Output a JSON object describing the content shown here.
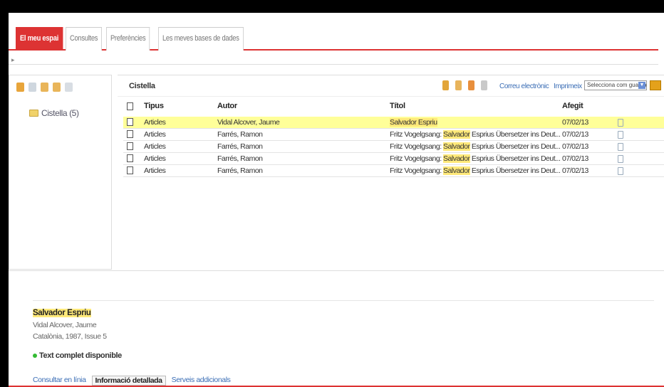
{
  "tabs": [
    "El meu espai",
    "Consultes",
    "Preferències",
    "Les meves bases de dades"
  ],
  "active_tab": 0,
  "basket": {
    "title": "Cistella",
    "folder_label": "Cistella (5)",
    "email_link": "Correu electrònic",
    "print_link": "Imprimeix",
    "select_value": "Selecciona com guardar"
  },
  "columns": {
    "type": "Tipus",
    "author": "Autor",
    "title": "Títol",
    "added": "Afegit"
  },
  "rows": [
    {
      "type": "Articles",
      "author": "Vidal Alcover, Jaume",
      "title_pre": "",
      "title_hl": "Salvador Espriu",
      "title_post": "",
      "added": "07/02/13",
      "highlighted": true
    },
    {
      "type": "Articles",
      "author": "Farrés, Ramon",
      "title_pre": "Fritz Vogelgsang: ",
      "title_hl": "Salvador",
      "title_post": " Esprius Übersetzer ins Deut...",
      "added": "07/02/13",
      "highlighted": false
    },
    {
      "type": "Articles",
      "author": "Farrés, Ramon",
      "title_pre": "Fritz Vogelgsang: ",
      "title_hl": "Salvador",
      "title_post": " Esprius Übersetzer ins Deut...",
      "added": "07/02/13",
      "highlighted": false
    },
    {
      "type": "Articles",
      "author": "Farrés, Ramon",
      "title_pre": "Fritz Vogelgsang: ",
      "title_hl": "Salvador",
      "title_post": " Esprius Übersetzer ins Deut...",
      "added": "07/02/13",
      "highlighted": false
    },
    {
      "type": "Articles",
      "author": "Farrés, Ramon",
      "title_pre": "Fritz Vogelgsang: ",
      "title_hl": "Salvador",
      "title_post": " Esprius Übersetzer ins Deut...",
      "added": "07/02/13",
      "highlighted": false
    }
  ],
  "detail": {
    "title": "Salvador Espriu",
    "author": "Vidal Alcover, Jaume",
    "source": "Catalònia, 1987, Issue 5",
    "fulltext": "Text complet disponible",
    "tabs": [
      "Consultar en línia",
      "Informació detallada",
      "Serveis addicionals"
    ]
  },
  "colors": {
    "accent": "#dd3333",
    "highlight": "#ffff99",
    "link": "#3a6db5"
  },
  "icons": [
    "folder-icon",
    "remove-icon",
    "copy-icon",
    "move-icon",
    "export-icon",
    "note-icon"
  ]
}
